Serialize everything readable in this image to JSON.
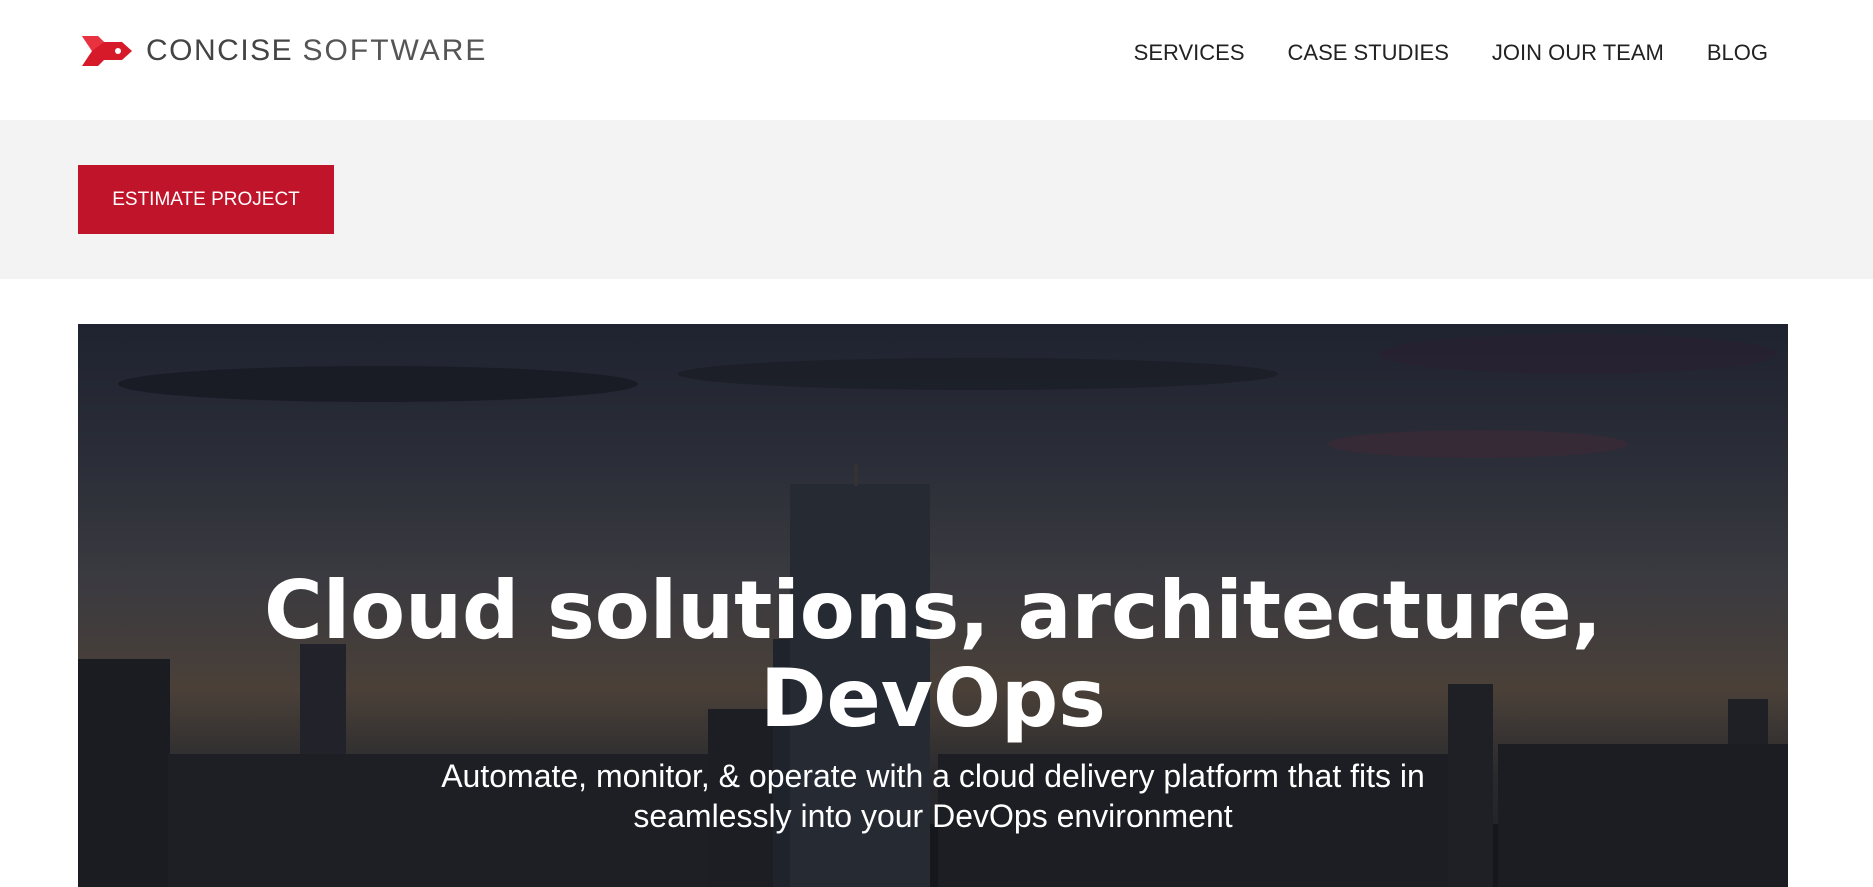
{
  "header": {
    "logo": {
      "part1": "CONCISE",
      "part2": "SOFTWARE"
    },
    "nav": [
      {
        "label": "SERVICES"
      },
      {
        "label": "CASE STUDIES"
      },
      {
        "label": "JOIN OUR TEAM"
      },
      {
        "label": "BLOG"
      }
    ]
  },
  "cta": {
    "label": "ESTIMATE PROJECT"
  },
  "hero": {
    "title": "Cloud solutions, architecture, DevOps",
    "subtitle": "Automate, monitor, & operate with a cloud delivery platform that fits in seamlessly into your DevOps environment"
  },
  "colors": {
    "brand": "#c0142b"
  }
}
